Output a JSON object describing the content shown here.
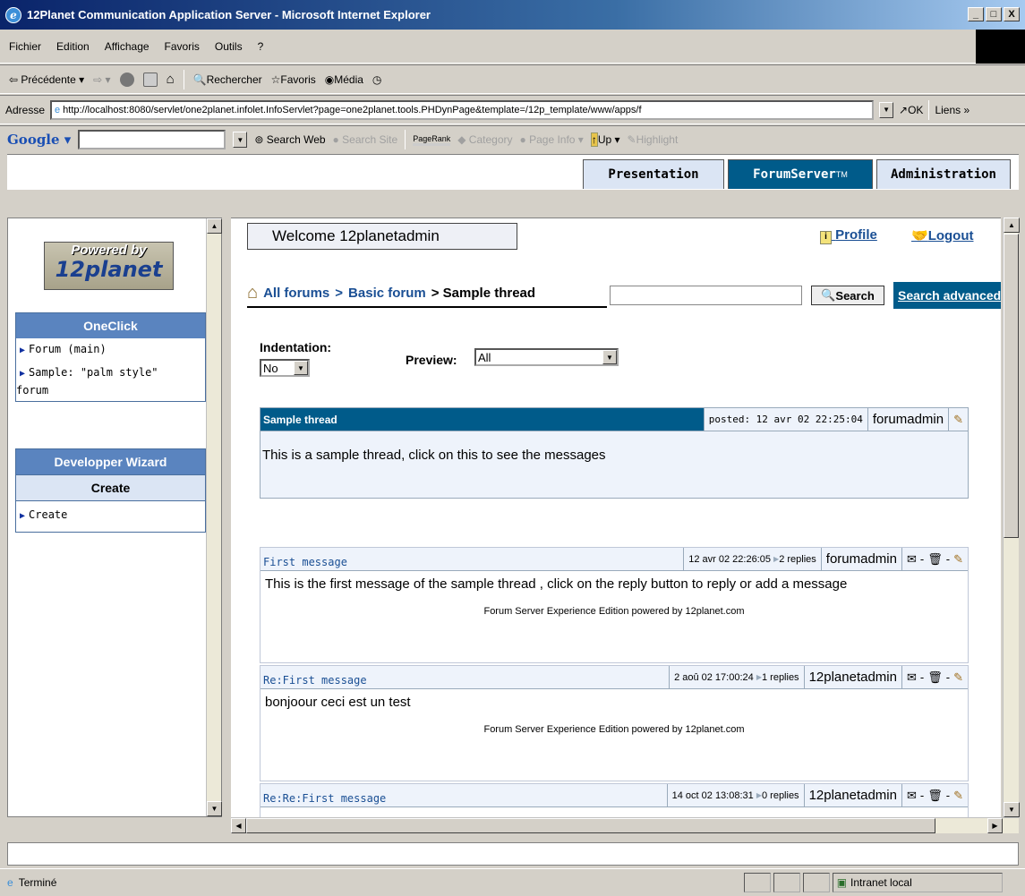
{
  "window": {
    "title": "12Planet Communication Application Server - Microsoft Internet Explorer",
    "min": "_",
    "max": "□",
    "close": "X"
  },
  "menu": [
    "Fichier",
    "Edition",
    "Affichage",
    "Favoris",
    "Outils",
    "?"
  ],
  "toolbar": {
    "back": "Précédente",
    "search": "Rechercher",
    "favorites": "Favoris",
    "media": "Média"
  },
  "address": {
    "label": "Adresse",
    "url": "http://localhost:8080/servlet/one2planet.infolet.InfoServlet?page=one2planet.tools.PHDynPage&template=/12p_template/www/apps/f",
    "go": "OK",
    "links": "Liens"
  },
  "google": {
    "logo": "Google",
    "search_web": "Search Web",
    "search_site": "Search Site",
    "pagerank": "PageRank",
    "category": "Category",
    "page_info": "Page Info",
    "up": "Up",
    "highlight": "Highlight"
  },
  "tabs": {
    "presentation": "Presentation",
    "forumserver": "ForumServer",
    "tm": "TM",
    "administration": "Administration"
  },
  "sidebar": {
    "logo_top": "Powered by",
    "logo_main": "12planet",
    "oneclick_title": "OneClick",
    "oneclick_items": [
      "Forum (main)",
      "Sample: \"palm style\""
    ],
    "oneclick_tail": "forum",
    "wizard_title": "Developper Wizard",
    "wizard_sub": "Create",
    "wizard_items": [
      "Create"
    ]
  },
  "main": {
    "welcome": "Welcome 12planetadmin",
    "profile": "Profile",
    "logout": "Logout",
    "crumb_all": "All forums",
    "crumb_sep": ">",
    "crumb_forum": "Basic forum",
    "crumb_thread": "> Sample thread",
    "search_btn": "Search",
    "search_adv": "Search advanced",
    "indent_label": "Indentation:",
    "indent_value": "No",
    "preview_label": "Preview:",
    "preview_value": "All"
  },
  "thread": {
    "title": "Sample thread",
    "posted": "posted: 12 avr 02 22:25:04",
    "author": "forumadmin",
    "body": "This is a sample thread, click on this to see the messages"
  },
  "messages": [
    {
      "title": "First message",
      "date": "12 avr 02 22:26:05",
      "replies": "2 replies",
      "author": "forumadmin",
      "body": "This is the first message of the sample thread , click on the reply button to reply or add a message",
      "footer": "Forum Server Experience Edition powered by 12planet.com"
    },
    {
      "title": "Re:First message",
      "date": "2 aoû 02 17:00:24",
      "replies": "1 replies",
      "author": "12planetadmin",
      "body": "bonjoour ceci est un test",
      "footer": "Forum Server Experience Edition powered by 12planet.com"
    },
    {
      "title": "Re:Re:First message",
      "date": "14 oct 02 13:08:31",
      "replies": "0 replies",
      "author": "12planetadmin"
    }
  ],
  "status": {
    "text": "Terminé",
    "zone": "Intranet local"
  }
}
